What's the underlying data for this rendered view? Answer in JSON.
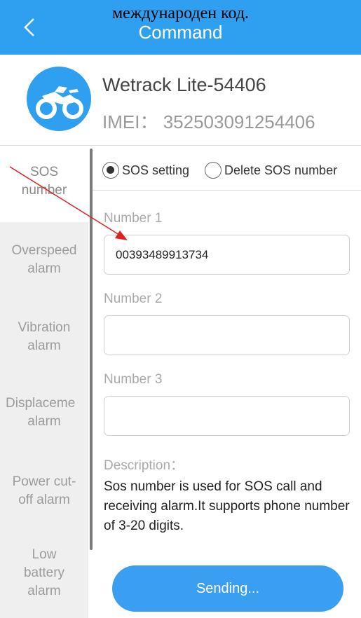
{
  "header": {
    "annotation": "международен код.",
    "title": "Command",
    "back_icon": "chevron-left-icon",
    "background_color": "#2f9ff0"
  },
  "device": {
    "name": "Wetrack Lite-54406",
    "imei_label": "IMEI：",
    "imei_value": "352503091254406",
    "icon": "motorcycle-icon"
  },
  "sidebar": {
    "items": [
      {
        "lines": [
          "SOS",
          "number"
        ],
        "active": true
      },
      {
        "lines": [
          "Overspeed",
          "alarm"
        ],
        "active": false
      },
      {
        "lines": [
          "Vibration",
          "alarm"
        ],
        "active": false
      },
      {
        "lines": [
          "Displaceme",
          "alarm"
        ],
        "active": false
      },
      {
        "lines": [
          "Power cut-",
          "off alarm"
        ],
        "active": false
      },
      {
        "lines": [
          "Low",
          "battery",
          "alarm"
        ],
        "active": false
      }
    ]
  },
  "main": {
    "radio_options": [
      {
        "label": "SOS setting",
        "checked": true
      },
      {
        "label": "Delete SOS number",
        "checked": false
      }
    ],
    "fields": [
      {
        "label": "Number 1",
        "value": "00393489913734"
      },
      {
        "label": "Number 2",
        "value": ""
      },
      {
        "label": "Number 3",
        "value": ""
      }
    ],
    "description_label": "Description：",
    "description_text": "Sos number is used for SOS call and receiving alarm.It supports phone number of 3-20 digits.",
    "send_button_label": "Sending...",
    "accent_color": "#3a9ff0"
  },
  "annotation_arrow_color": "#e02020"
}
